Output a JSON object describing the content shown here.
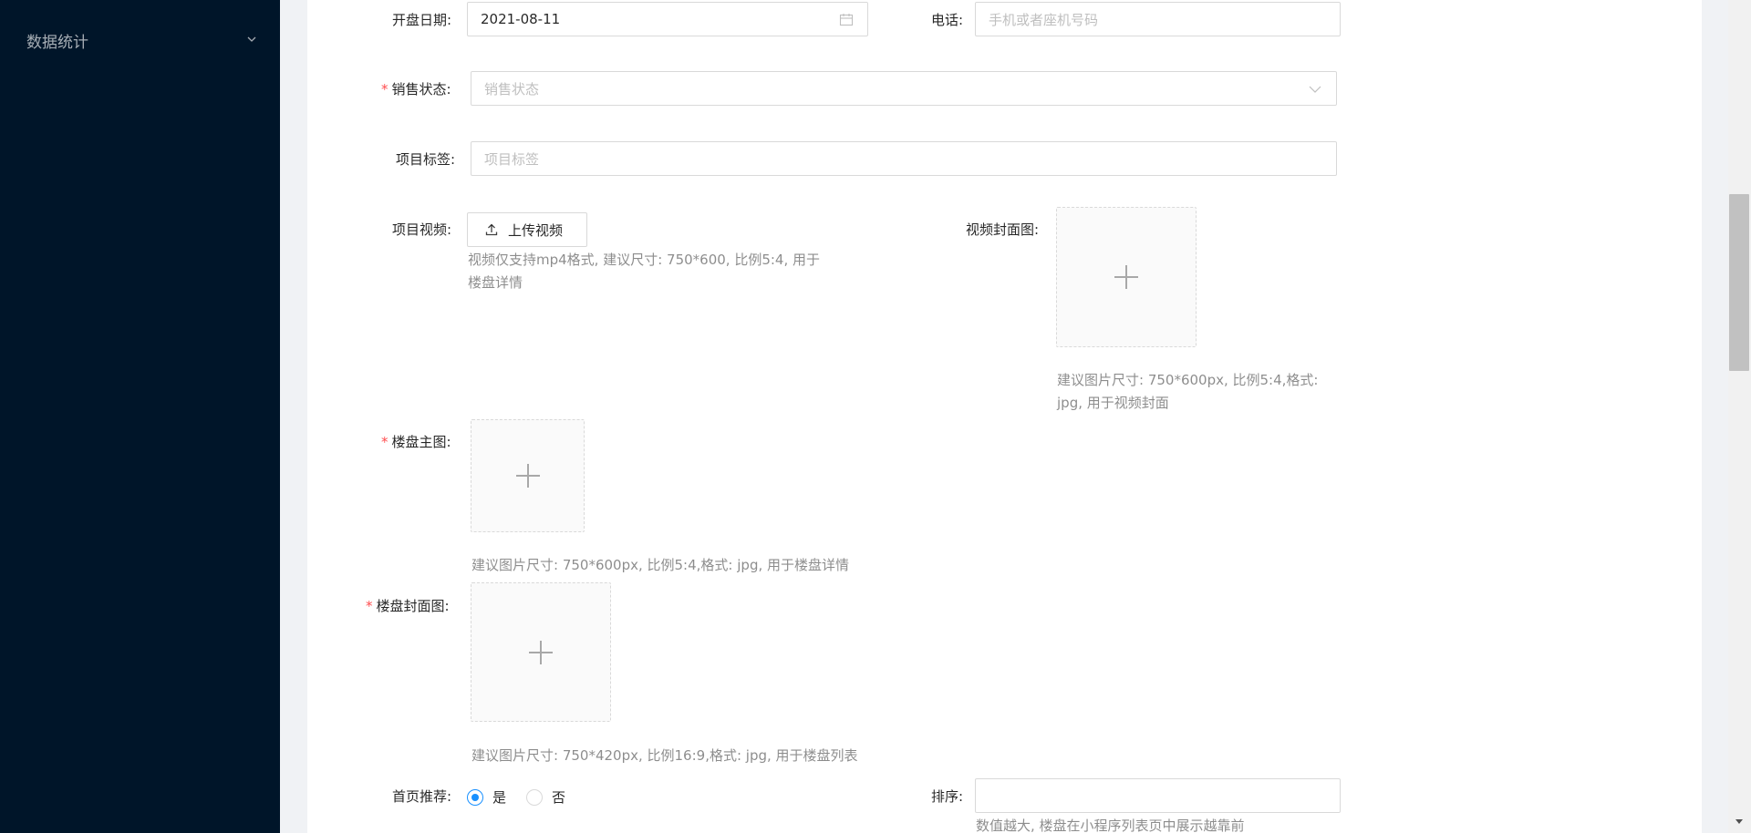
{
  "sidebar": {
    "menu_label": "数据统计",
    "arrow_icon": "chevron-down-icon"
  },
  "form": {
    "open_date": {
      "label": "开盘日期:",
      "value": "2021-08-11",
      "icon": "calendar-icon"
    },
    "phone": {
      "label": "电话:",
      "placeholder": "手机或者座机号码"
    },
    "sale_status": {
      "label": "销售状态:",
      "placeholder": "销售状态",
      "required": true,
      "icon": "chevron-down-icon"
    },
    "tags": {
      "label": "项目标签:",
      "placeholder": "项目标签"
    },
    "video": {
      "label": "项目视频:",
      "button_label": "上传视频",
      "button_icon": "upload-icon",
      "hint_line1": "视频仅支持mp4格式, 建议尺寸: 750*600, 比例5:4, 用于",
      "hint_line2": "楼盘详情"
    },
    "video_cover": {
      "label": "视频封面图:",
      "hint_line1": "建议图片尺寸: 750*600px, 比例5:4,格式:",
      "hint_line2": "jpg, 用于视频封面"
    },
    "main_image": {
      "label": "楼盘主图:",
      "required": true,
      "hint": "建议图片尺寸: 750*600px, 比例5:4,格式: jpg, 用于楼盘详情"
    },
    "cover_image": {
      "label": "楼盘封面图:",
      "required": true,
      "hint": "建议图片尺寸: 750*420px, 比例16:9,格式: jpg, 用于楼盘列表"
    },
    "home_recommend": {
      "label": "首页推荐:",
      "options": [
        {
          "label": "是",
          "checked": true
        },
        {
          "label": "否",
          "checked": false
        }
      ]
    },
    "sort": {
      "label": "排序:",
      "value": "",
      "hint": "数值越大, 楼盘在小程序列表页中展示越靠前"
    }
  },
  "colors": {
    "sidebar_bg": "#001529",
    "primary": "#1890ff",
    "required": "#ff4d4f"
  }
}
